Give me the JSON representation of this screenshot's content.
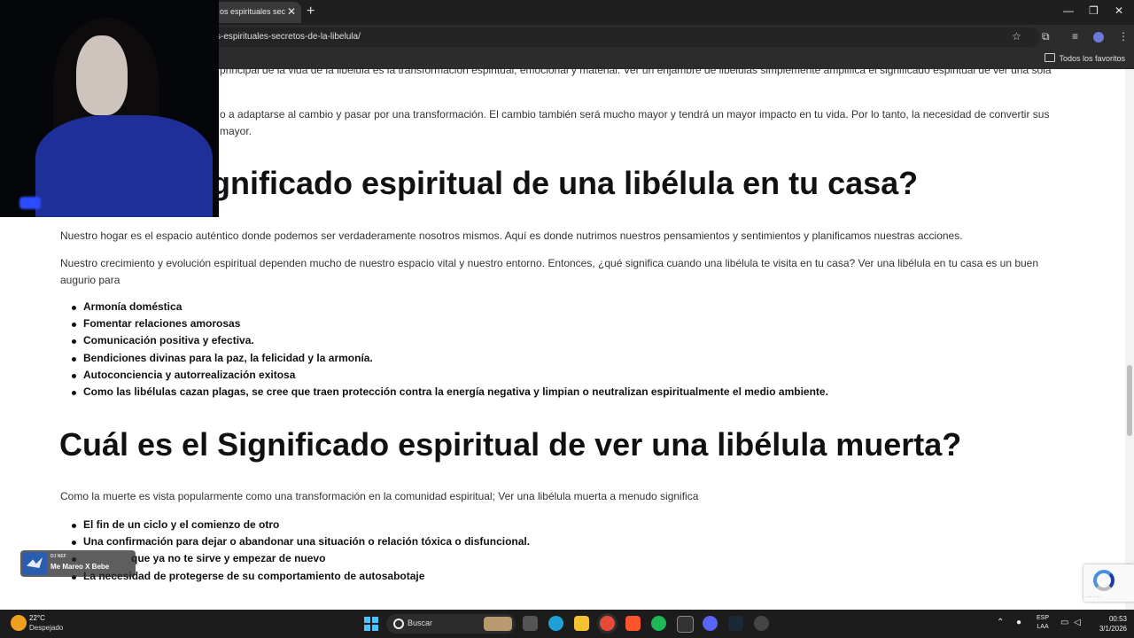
{
  "browser": {
    "tab_title": "os espirituales secre",
    "url": "s-espirituales-secretos-de-la-libelula/",
    "bookmarks_label": "Todos los favoritos"
  },
  "article": {
    "top_clipped": "principal de la vida de la libélula es la transformación espiritual, emocional y material. Ver un enjambre de libélulas simplemente amplifica el significado espiritual de ver una sola",
    "top_paragraph_line1": "o a adaptarse al cambio y pasar por una transformación. El cambio también será mucho mayor y tendrá un mayor impacto en tu vida. Por lo tanto, la necesidad de convertir sus",
    "top_paragraph_line2": "mayor.",
    "heading1": "ignificado espiritual de una libélula en tu casa?",
    "para1": "Nuestro hogar es el espacio auténtico donde podemos ser verdaderamente nosotros mismos. Aquí es donde nutrimos nuestros pensamientos y sentimientos y planificamos nuestras acciones.",
    "para2": "Nuestro crecimiento y evolución espiritual dependen mucho de nuestro espacio vital y nuestro entorno. Entonces, ¿qué significa cuando una libélula te visita en tu casa? Ver una libélula en tu casa es un buen augurio para",
    "list1": [
      "Armonía doméstica",
      "Fomentar relaciones amorosas",
      "Comunicación positiva y efectiva.",
      "Bendiciones divinas para la paz, la felicidad y la armonía.",
      "Autoconciencia y autorrealización exitosa",
      "Como las libélulas cazan plagas, se cree que traen protección contra la energía negativa y limpian o neutralizan espiritualmente el medio ambiente."
    ],
    "heading2": "Cuál es el Significado espiritual de ver una libélula muerta?",
    "para3": "Como la muerte es vista popularmente como una transformación en la comunidad espiritual; Ver una libélula muerta a menudo significa",
    "list2": [
      "El fin de un ciclo y el comienzo de otro",
      "Una confirmación para dejar o abandonar una situación o relación tóxica o disfuncional.",
      "que ya no te sirve y empezar de nuevo",
      "La necesidad de protegerse de su comportamiento de autosabotaje"
    ]
  },
  "music_widget": {
    "artist": "DJ NEF",
    "title": "Me Mareo X Bebe"
  },
  "taskbar": {
    "temperature": "22°C",
    "weather": "Despejado",
    "search_label": "Buscar",
    "lang_line1": "ESP",
    "lang_line2": "LAA",
    "time": "00:53",
    "date": "3/1/2026"
  },
  "colors": {
    "taskbar_bg": "#1c1c1c",
    "chrome_bg": "#2c2c2c",
    "webcam_shirt": "#1f2f99"
  }
}
